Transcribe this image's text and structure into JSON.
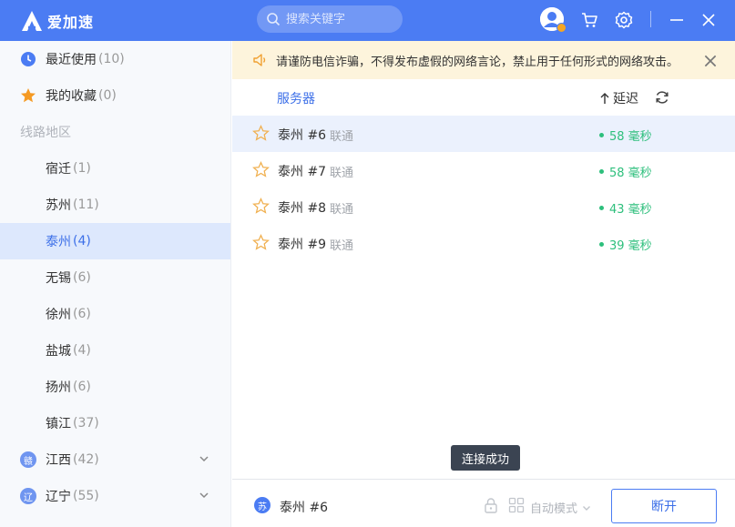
{
  "app": {
    "title": "爱加速"
  },
  "search": {
    "placeholder": "搜索关键字"
  },
  "sidebar": {
    "recent": {
      "label": "最近使用",
      "count": "(10)"
    },
    "favorites": {
      "label": "我的收藏",
      "count": "(0)"
    },
    "section_label": "线路地区",
    "cities": [
      {
        "label": "宿迁",
        "count": "(1)"
      },
      {
        "label": "苏州",
        "count": "(11)"
      },
      {
        "label": "泰州",
        "count": "(4)"
      },
      {
        "label": "无锡",
        "count": "(6)"
      },
      {
        "label": "徐州",
        "count": "(6)"
      },
      {
        "label": "盐城",
        "count": "(4)"
      },
      {
        "label": "扬州",
        "count": "(6)"
      },
      {
        "label": "镇江",
        "count": "(37)"
      }
    ],
    "provinces": [
      {
        "badge": "赣",
        "label": "江西",
        "count": "(42)"
      },
      {
        "badge": "辽",
        "label": "辽宁",
        "count": "(55)"
      }
    ]
  },
  "notice": {
    "text": "请谨防电信诈骗，不得发布虚假的网络言论，禁止用于任何形式的网络攻击。"
  },
  "list": {
    "col_server": "服务器",
    "col_latency": "延迟",
    "rows": [
      {
        "name": "泰州 #6",
        "isp": "联通",
        "latency": "58 毫秒"
      },
      {
        "name": "泰州 #7",
        "isp": "联通",
        "latency": "58 毫秒"
      },
      {
        "name": "泰州 #8",
        "isp": "联通",
        "latency": "43 毫秒"
      },
      {
        "name": "泰州 #9",
        "isp": "联通",
        "latency": "39 毫秒"
      }
    ]
  },
  "toast": {
    "text": "连接成功"
  },
  "bottom": {
    "badge": "苏",
    "current": "泰州 #6",
    "mode": "自动模式",
    "disconnect": "断开"
  },
  "colors": {
    "primary": "#4b7cf3",
    "latency": "#2dbf7c",
    "notice_bg": "#fdf4dc"
  }
}
